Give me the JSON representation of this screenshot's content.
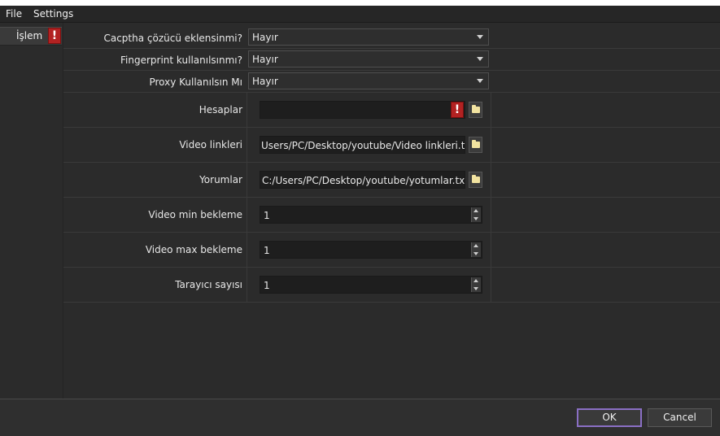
{
  "menu": {
    "file": "File",
    "settings": "Settings"
  },
  "sidebar": {
    "items": [
      {
        "label": "İşlem",
        "warning": "!"
      }
    ]
  },
  "form": {
    "captcha": {
      "label": "Cacptha çözücü eklensinmi?",
      "value": "Hayır"
    },
    "fingerprint": {
      "label": "Fingerprint kullanılsınmı?",
      "value": "Hayır"
    },
    "proxy": {
      "label": "Proxy Kullanılsın Mı",
      "value": "Hayır"
    },
    "hesaplar": {
      "label": "Hesaplar",
      "value": "",
      "warning": "!"
    },
    "video_links": {
      "label": "Video linkleri",
      "value": "Users/PC/Desktop/youtube/Video linkleri.txt"
    },
    "yorumlar": {
      "label": "Yorumlar",
      "value": "C:/Users/PC/Desktop/youtube/yotumlar.txt"
    },
    "video_min": {
      "label": "Video min bekleme",
      "value": "1"
    },
    "video_max": {
      "label": "Video max bekleme",
      "value": "1"
    },
    "browser_count": {
      "label": "Tarayıcı sayısı",
      "value": "1"
    }
  },
  "buttons": {
    "ok": "OK",
    "cancel": "Cancel"
  },
  "colors": {
    "warning": "#b22222",
    "accent": "#8a6fc4",
    "background": "#2b2b2b"
  }
}
